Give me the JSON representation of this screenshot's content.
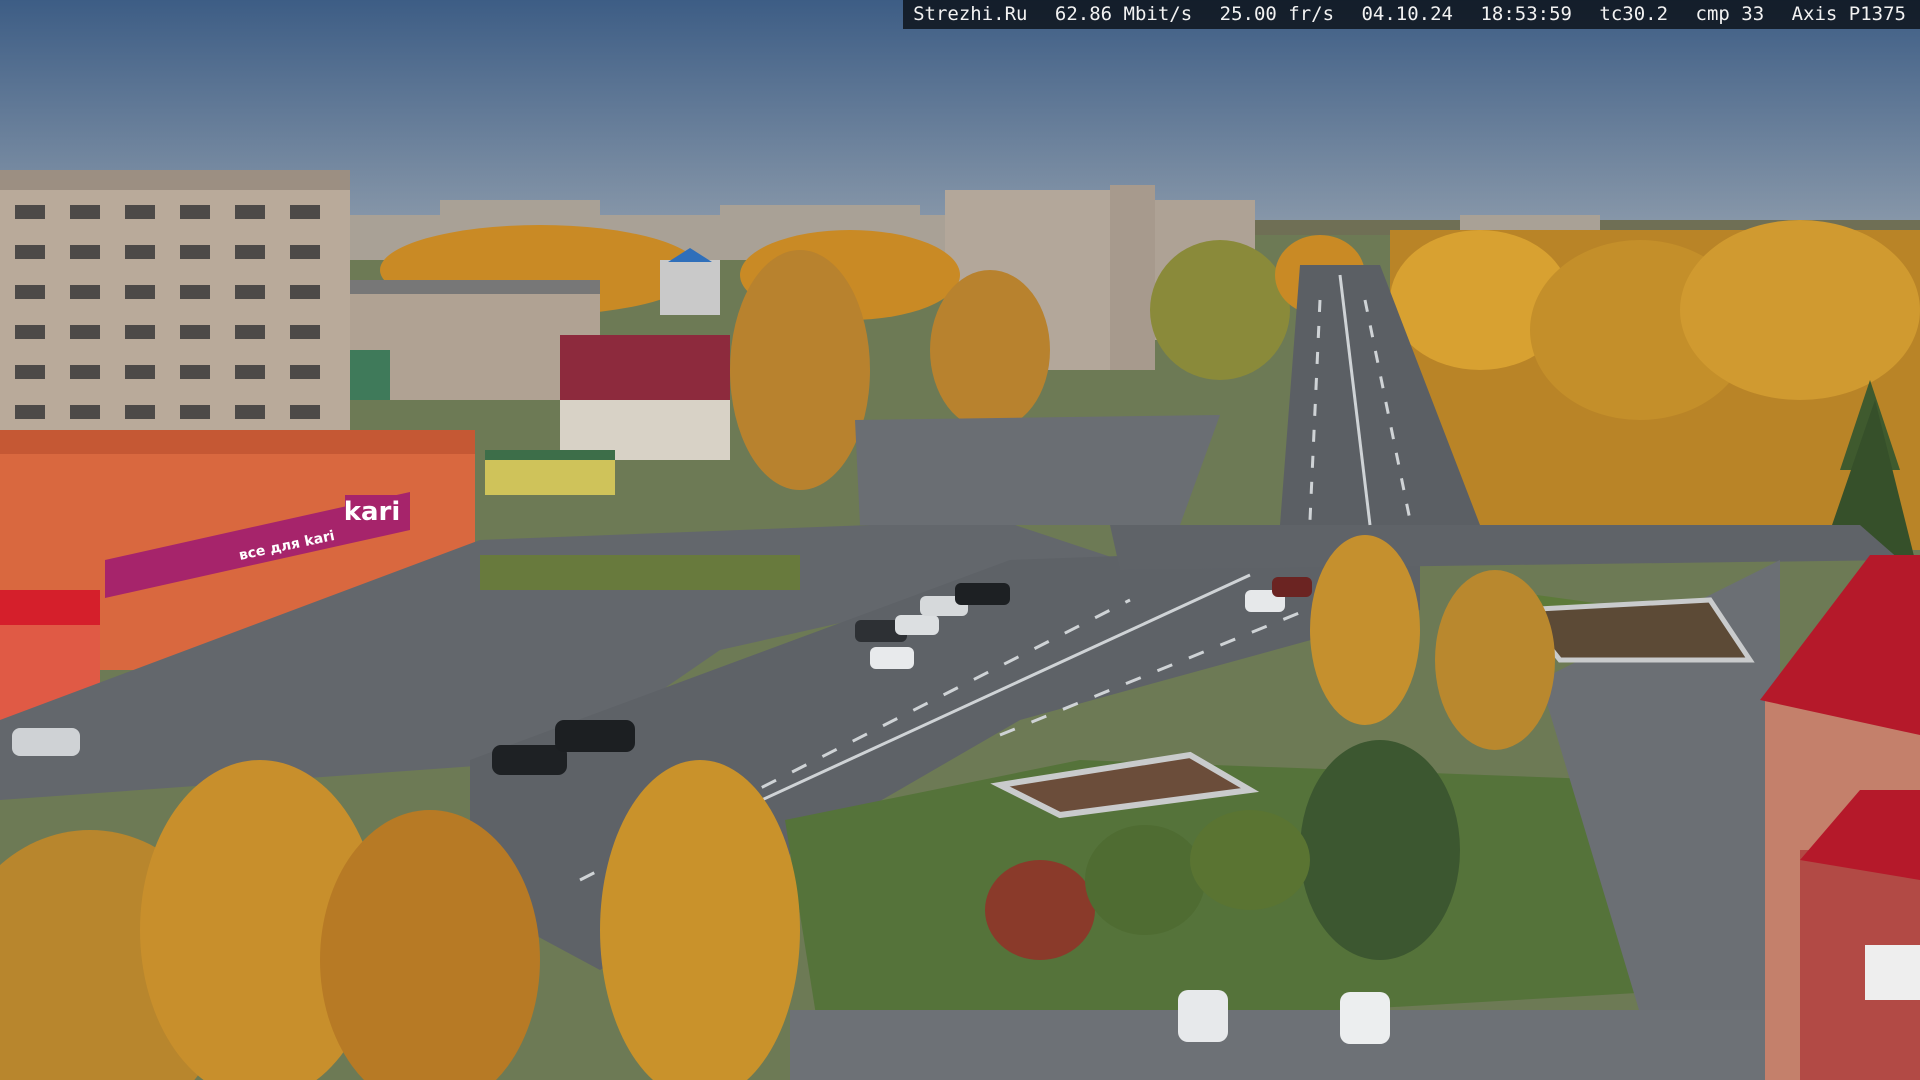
{
  "overlay": {
    "site": "Strezhi.Ru",
    "bitrate": "62.86 Mbit/s",
    "framerate": "25.00 fr/s",
    "date": "04.10.24",
    "time": "18:53:59",
    "tc": "tc30.2",
    "cmp": "cmp 33",
    "camera": "Axis P1375"
  },
  "signage": {
    "store_logo": "kari",
    "store_banner": "все для kari"
  },
  "colors": {
    "sky_top": "#3f5f86",
    "sky_bottom": "#8596a8",
    "foliage": "#c98a25",
    "asphalt": "#5d6166",
    "grass": "#5d7a3a",
    "store_facade": "#d9683f",
    "store_sign": "#a6246b",
    "red_roof": "#b5192a"
  }
}
